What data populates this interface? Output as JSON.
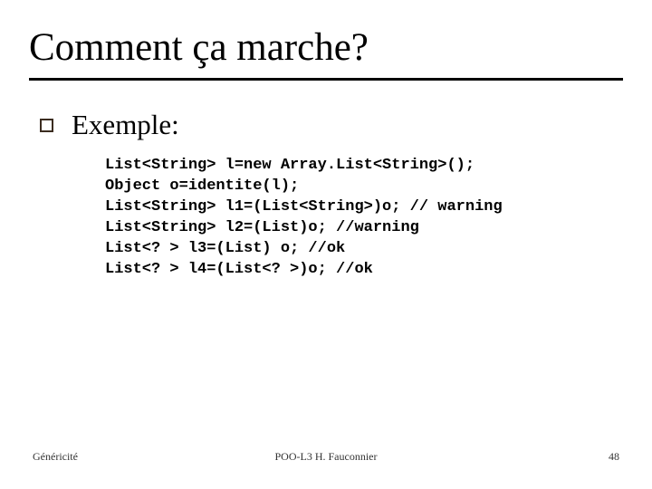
{
  "title": "Comment ça marche?",
  "bullet": "Exemple:",
  "code": [
    "List<String> l=new Array.List<String>();",
    "Object o=identite(l);",
    "List<String> l1=(List<String>)o; // warning",
    "List<String> l2=(List)o; //warning",
    "List<? > l3=(List) o; //ok",
    "List<? > l4=(List<? >)o; //ok"
  ],
  "footer": {
    "left": "Généricité",
    "center": "POO-L3 H. Fauconnier",
    "right": "48"
  }
}
